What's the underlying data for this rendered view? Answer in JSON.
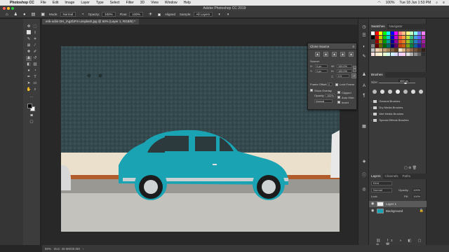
{
  "menubar": {
    "apple": "",
    "app_name": "Photoshop CC",
    "items": [
      "File",
      "Edit",
      "Image",
      "Layer",
      "Type",
      "Select",
      "Filter",
      "3D",
      "View",
      "Window",
      "Help"
    ],
    "battery": "100%",
    "clock": "Tue 18 Jun  1:53 PM"
  },
  "window": {
    "title": "Adobe Photoshop CC 2019"
  },
  "options_bar": {
    "mode_label": "Mode:",
    "mode_value": "Normal",
    "opacity_label": "Opacity:",
    "opacity_value": "100%",
    "flow_label": "Flow:",
    "flow_value": "100%",
    "aligned_label": "Aligned",
    "sample_label": "Sample:",
    "sample_value": "All Layers"
  },
  "document": {
    "tab_title": "erik-odiin-DH_lAgZlJP4-unsplash.jpg @ 50% (Layer 1, RGB/8) *"
  },
  "clone_source": {
    "title": "Clone Source",
    "source_label": "Source:",
    "x_label": "X:",
    "x_value": "0 px",
    "y_label": "Y:",
    "y_value": "0 px",
    "w_label": "W:",
    "w_value": "100.0%",
    "h_label": "H:",
    "h_value": "100.0%",
    "angle_value": "0.0",
    "frame_offset_label": "Frame Offset:",
    "frame_offset_value": "0",
    "lock_frame_label": "Lock Frame",
    "show_overlay_label": "Show Overlay",
    "opacity_label": "Opacity:",
    "opacity_value": "100%",
    "blend_value": "Normal",
    "clipped_label": "Clipped",
    "auto_hide_label": "Auto Hide",
    "invert_label": "Invert"
  },
  "swatches": {
    "tabs": [
      "Swatches",
      "Navigator"
    ],
    "colors": [
      [
        "#ffffff",
        "#ff0000",
        "#ffff00",
        "#00ff00",
        "#00ffff",
        "#0000ff",
        "#ff00ff",
        "#ff8080",
        "#ffc080",
        "#ffff80",
        "#c0ffc0",
        "#80ffff",
        "#8080ff",
        "#ff80ff"
      ],
      [
        "#000000",
        "#cc0000",
        "#cccc00",
        "#00cc00",
        "#00cccc",
        "#0000cc",
        "#cc00cc",
        "#ff6040",
        "#ffa040",
        "#c0e040",
        "#40c080",
        "#40a0e0",
        "#6060ff",
        "#c040c0"
      ],
      [
        "#404040",
        "#990000",
        "#999900",
        "#009900",
        "#009999",
        "#000099",
        "#990099",
        "#e05020",
        "#e08020",
        "#a0c020",
        "#20a060",
        "#2080c0",
        "#4040c0",
        "#a020a0"
      ],
      [
        "#808080",
        "#660000",
        "#666600",
        "#006600",
        "#006666",
        "#000066",
        "#660066",
        "#c04010",
        "#c06010",
        "#80a010",
        "#108040",
        "#1060a0",
        "#2020a0",
        "#801080"
      ],
      [
        "#c0c0c0",
        "#f0d0b0",
        "#e0c090",
        "#c0a070",
        "#a08050",
        "#806040",
        "#604020",
        "#f5e6c8",
        "#d8b080",
        "#b08860",
        "#906848",
        "#705038",
        "#503828",
        "#302018"
      ],
      [
        "#ffe0e0",
        "#ffe8d0",
        "#fff8d0",
        "#e8ffd0",
        "#d0fff0",
        "#d0f0ff",
        "#d8d8ff",
        "#f0d0ff",
        "#ffd0f0",
        "#e0e0e0",
        "#b0b0b0",
        "#909090",
        "#606060",
        "#303030"
      ]
    ]
  },
  "brushes": {
    "title": "Brushes",
    "size_label": "Size:",
    "size_value": "400 px",
    "folders": [
      "General Brushes",
      "Dry Media Brushes",
      "Wet Media Brushes",
      "Special Effects Brushes"
    ]
  },
  "layers": {
    "tabs": [
      "Layers",
      "Channels",
      "Paths"
    ],
    "kind_label": "Kind",
    "blend_mode": "Normal",
    "opacity_label": "Opacity:",
    "opacity_value": "100%",
    "lock_label": "Lock:",
    "fill_label": "Fill:",
    "fill_value": "100%",
    "items": [
      {
        "name": "Layer 1",
        "selected": true
      },
      {
        "name": "Background",
        "selected": false
      }
    ]
  },
  "status": {
    "zoom": "50%",
    "doc_size": "Doc: 40.0M/40.0M"
  },
  "colors": {
    "wall": "#34494e",
    "car": "#1aa3b3",
    "sidewalk": "#a4a29c",
    "road": "#c7c5c0"
  }
}
